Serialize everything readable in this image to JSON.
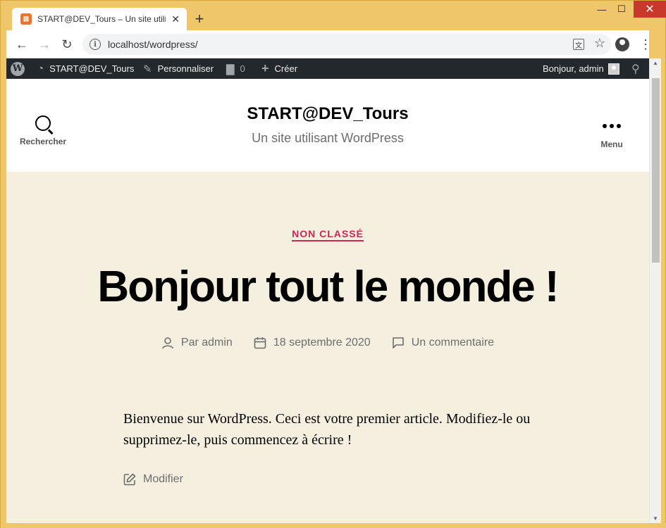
{
  "browser": {
    "tab_title": "START@DEV_Tours – Un site utili",
    "tab_close": "✕",
    "new_tab": "+",
    "url": "localhost/wordpress/",
    "window_min": "—",
    "window_max": "☐",
    "window_close": "✕"
  },
  "adminbar": {
    "site_name": "START@DEV_Tours",
    "customize": "Personnaliser",
    "comments_count": "0",
    "new": "Créer",
    "greeting": "Bonjour, admin"
  },
  "header": {
    "search_label": "Rechercher",
    "site_title": "START@DEV_Tours",
    "site_description": "Un site utilisant WordPress",
    "menu_label": "Menu"
  },
  "post": {
    "category": "NON CLASSÉ",
    "title": "Bonjour tout le monde !",
    "author": "Par admin",
    "date": "18 septembre 2020",
    "comments": "Un commentaire",
    "excerpt": "Bienvenue sur WordPress. Ceci est votre premier article. Modifiez-le ou supprimez-le, puis commencez à écrire !",
    "edit_label": "Modifier"
  },
  "colors": {
    "window_frame": "#f0c66a",
    "adminbar_bg": "#23282d",
    "accent": "#cd2653",
    "content_bg": "#f5efe0"
  }
}
